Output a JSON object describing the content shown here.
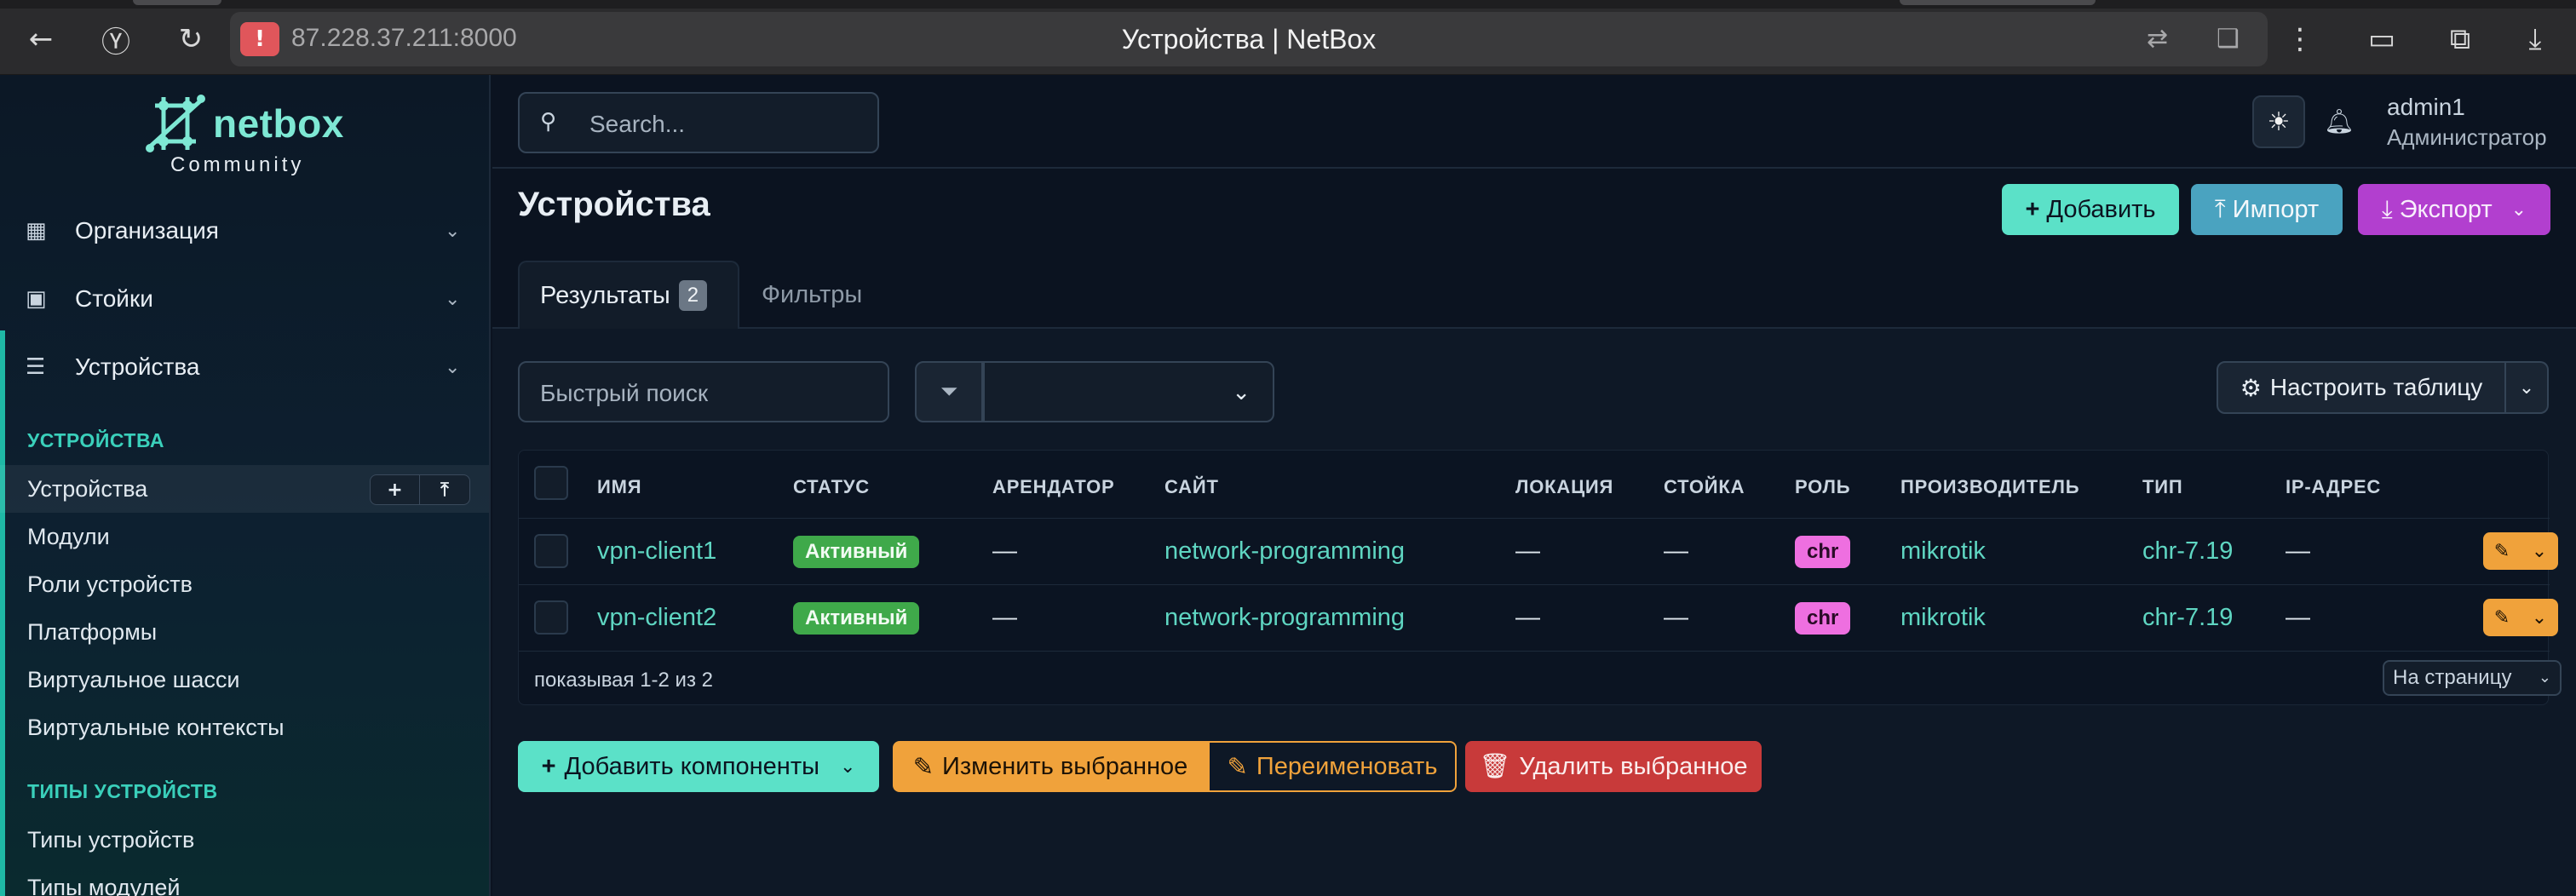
{
  "browser": {
    "url": "87.228.37.211:8000",
    "title": "Устройства | NetBox"
  },
  "logo": {
    "name": "netbox",
    "sub": "Community"
  },
  "sidebar": {
    "groups": [
      {
        "label": "Организация",
        "icon": "building-icon"
      },
      {
        "label": "Стойки",
        "icon": "rack-icon"
      },
      {
        "label": "Устройства",
        "icon": "server-icon"
      }
    ],
    "sections": [
      {
        "heading": "УСТРОЙСТВА",
        "items": [
          "Устройства",
          "Модули",
          "Роли устройств",
          "Платформы",
          "Виртуальное шасси",
          "Виртуальные контексты"
        ]
      },
      {
        "heading": "ТИПЫ УСТРОЙСТВ",
        "items": [
          "Типы устройств",
          "Типы модулей"
        ]
      }
    ]
  },
  "topnav": {
    "search_placeholder": "Search...",
    "user_name": "admin1",
    "user_role": "Администратор"
  },
  "page": {
    "title": "Устройства",
    "add_label": "Добавить",
    "import_label": "Импорт",
    "export_label": "Экспорт"
  },
  "tabs": {
    "results_label": "Результаты",
    "results_count": "2",
    "filters_label": "Фильтры"
  },
  "controls": {
    "quick_search_placeholder": "Быстрый поиск",
    "configure_table_label": "Настроить таблицу"
  },
  "table": {
    "columns": [
      "ИМЯ",
      "СТАТУС",
      "АРЕНДАТОР",
      "САЙТ",
      "ЛОКАЦИЯ",
      "СТОЙКА",
      "РОЛЬ",
      "ПРОИЗВОДИТЕЛЬ",
      "ТИП",
      "IP-АДРЕС"
    ],
    "rows": [
      {
        "name": "vpn-client1",
        "status": "Активный",
        "tenant": "—",
        "site": "network-programming",
        "location": "—",
        "rack": "—",
        "role": "chr",
        "manufacturer": "mikrotik",
        "type": "chr-7.19",
        "ip": "—"
      },
      {
        "name": "vpn-client2",
        "status": "Активный",
        "tenant": "—",
        "site": "network-programming",
        "location": "—",
        "rack": "—",
        "role": "chr",
        "manufacturer": "mikrotik",
        "type": "chr-7.19",
        "ip": "—"
      }
    ],
    "footer_text": "показывая 1-2 из 2",
    "per_page_label": "На страницу"
  },
  "bulk": {
    "add_components": "Добавить компоненты",
    "edit_selected": "Изменить выбранное",
    "rename": "Переименовать",
    "delete_selected": "Удалить выбранное"
  },
  "colors": {
    "accent": "#5be1c8",
    "import": "#4aa3c0",
    "export": "#b23fcf",
    "status_active": "#3fa94a",
    "role_chr": "#ee6fe0",
    "warning": "#f0a23b",
    "danger": "#c83a3a"
  }
}
